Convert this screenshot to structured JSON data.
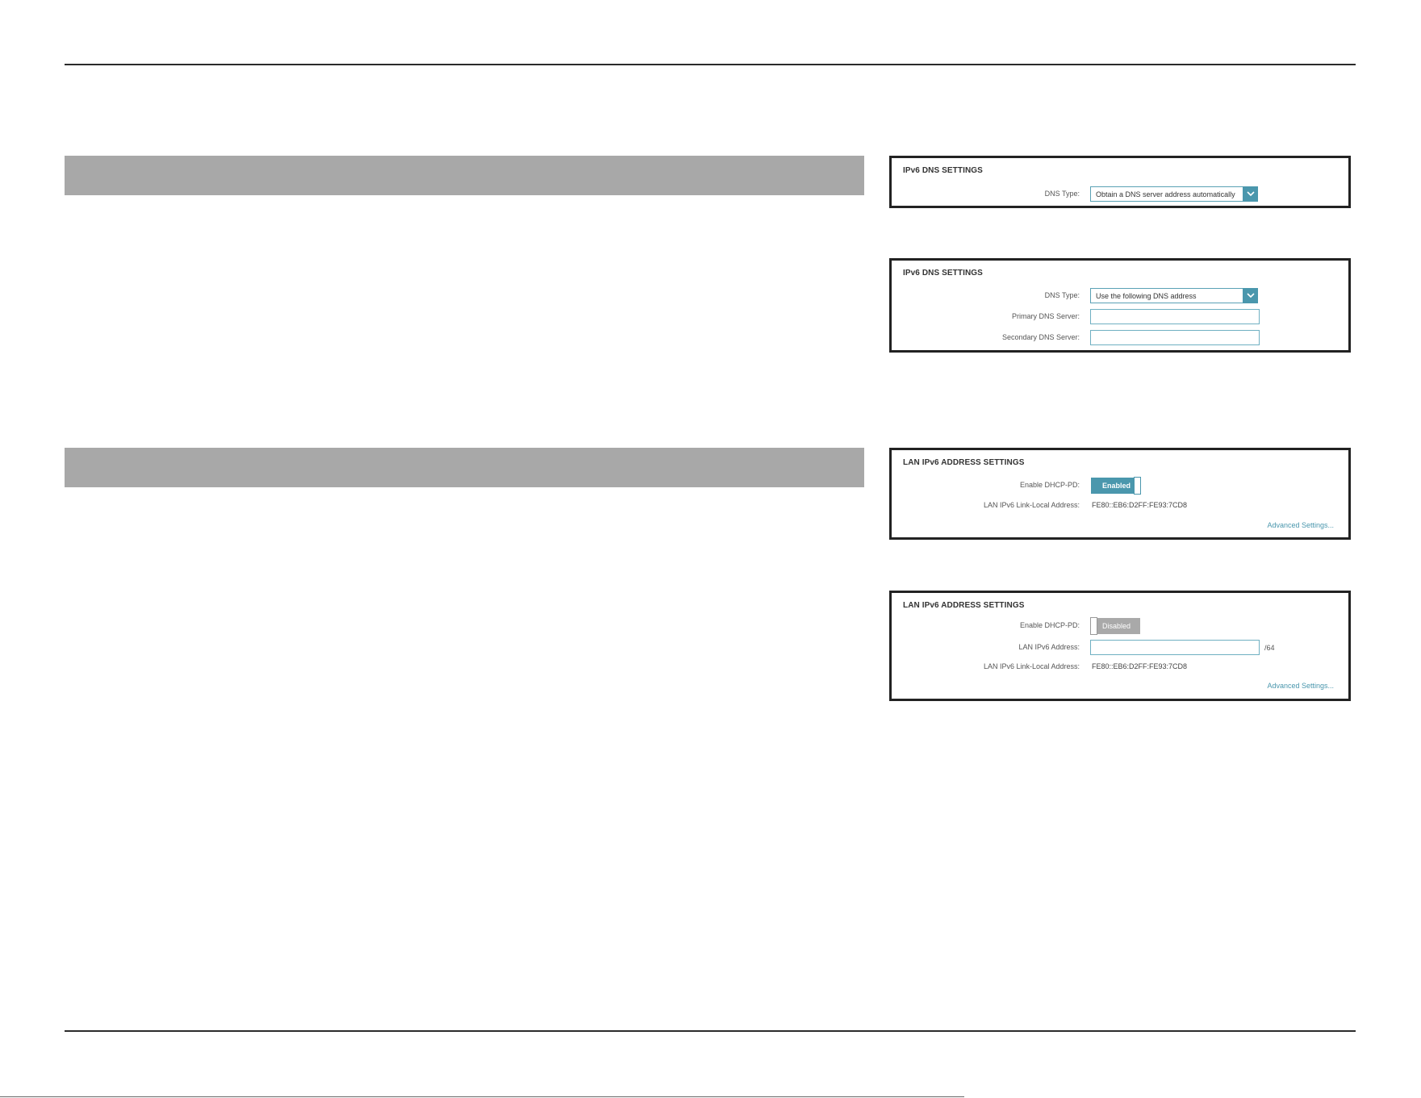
{
  "dns_auto_panel": {
    "title": "IPv6 DNS SETTINGS",
    "dns_type_label": "DNS Type:",
    "dns_type_value": "Obtain a DNS server address automatically"
  },
  "dns_manual_panel": {
    "title": "IPv6 DNS SETTINGS",
    "dns_type_label": "DNS Type:",
    "dns_type_value": "Use the following DNS address",
    "primary_label": "Primary DNS Server:",
    "primary_value": "",
    "secondary_label": "Secondary DNS Server:",
    "secondary_value": ""
  },
  "lan_enabled_panel": {
    "title": "LAN IPv6 ADDRESS SETTINGS",
    "dhcp_pd_label": "Enable DHCP-PD:",
    "dhcp_pd_state": "Enabled",
    "link_local_label": "LAN IPv6 Link-Local Address:",
    "link_local_value": "FE80::EB6:D2FF:FE93:7CD8",
    "advanced_link": "Advanced Settings..."
  },
  "lan_disabled_panel": {
    "title": "LAN IPv6 ADDRESS SETTINGS",
    "dhcp_pd_label": "Enable DHCP-PD:",
    "dhcp_pd_state": "Disabled",
    "lan_address_label": "LAN IPv6 Address:",
    "lan_address_value": "",
    "prefix_suffix": "/64",
    "link_local_label": "LAN IPv6 Link-Local Address:",
    "link_local_value": "FE80::EB6:D2FF:FE93:7CD8",
    "advanced_link": "Advanced Settings..."
  },
  "colors": {
    "accent": "#4a97ad",
    "section_bar": "#a8a8a8",
    "toggle_off": "#a9a9a9"
  },
  "icons": {
    "dropdown": "chevron-down-icon"
  }
}
